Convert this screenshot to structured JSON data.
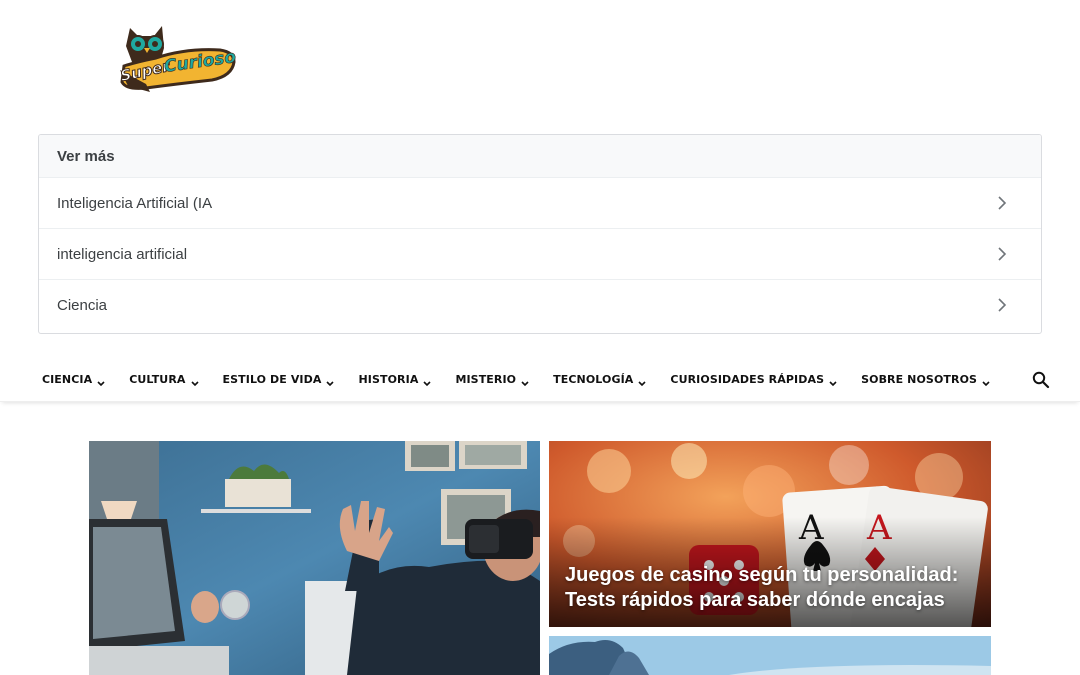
{
  "logo": {
    "text_top": "Super",
    "text_main": "Curioso",
    "alt": "SuperCurioso"
  },
  "related": {
    "header": "Ver más",
    "items": [
      {
        "label": "Inteligencia Artificial (IA"
      },
      {
        "label": "inteligencia artificial"
      },
      {
        "label": "Ciencia"
      }
    ]
  },
  "nav": {
    "items": [
      {
        "label": "CIENCIA"
      },
      {
        "label": "CULTURA"
      },
      {
        "label": "ESTILO DE VIDA"
      },
      {
        "label": "HISTORIA"
      },
      {
        "label": "MISTERIO"
      },
      {
        "label": "TECNOLOGÍA"
      },
      {
        "label": "CURIOSIDADES RÁPIDAS"
      },
      {
        "label": "SOBRE NOSOTROS"
      }
    ],
    "search_icon": "search-icon"
  },
  "featured": {
    "left": {
      "title": "",
      "image": "vr-headset-man"
    },
    "right_top": {
      "title": "Juegos de casino según tu personalidad: Tests rápidos para saber dónde encajas",
      "image": "playing-cards-dice"
    },
    "right_bottom": {
      "title": "",
      "image": "mountain-sky"
    }
  },
  "colors": {
    "logo_teal": "#1fa9a0",
    "logo_yellow": "#f2b431",
    "logo_brown": "#3e2a1c"
  }
}
